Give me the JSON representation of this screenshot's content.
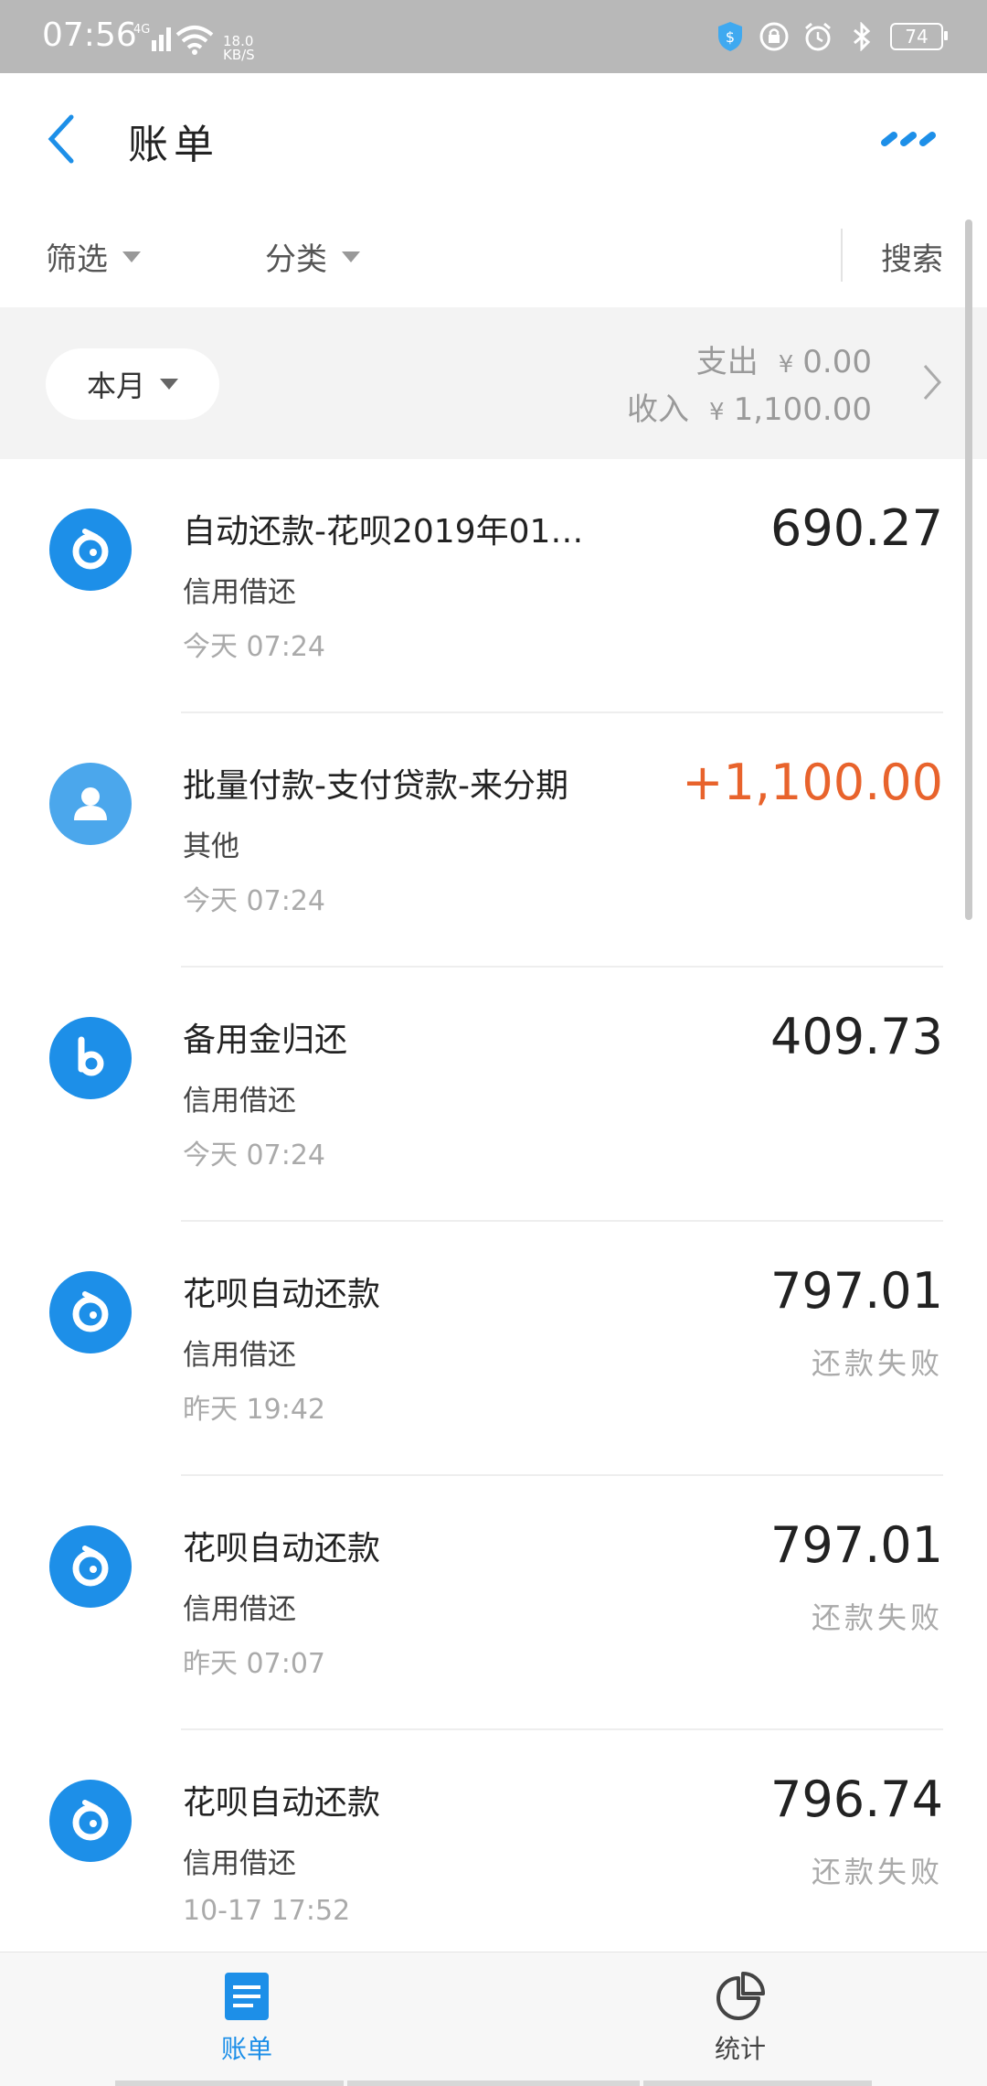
{
  "status_bar": {
    "time": "07:56",
    "network": "4G",
    "speed_value": "18.0",
    "speed_unit": "KB/S",
    "battery": "74"
  },
  "header": {
    "title": "账单"
  },
  "filters": {
    "filter_label": "筛选",
    "category_label": "分类",
    "search_label": "搜索"
  },
  "summary": {
    "month_label": "本月",
    "expense_label": "支出",
    "expense_value": "0.00",
    "income_label": "收入",
    "income_value": "1,100.00",
    "currency": "¥"
  },
  "transactions": [
    {
      "title": "自动还款-花呗2019年01…",
      "category": "信用借还",
      "time": "今天 07:24",
      "amount": "690.27",
      "status": "",
      "icon": "huabei-icon",
      "income": false
    },
    {
      "title": "批量付款-支付贷款-来分期",
      "category": "其他",
      "time": "今天 07:24",
      "amount": "+1,100.00",
      "status": "",
      "icon": "person-icon",
      "income": true
    },
    {
      "title": "备用金归还",
      "category": "信用借还",
      "time": "今天 07:24",
      "amount": "409.73",
      "status": "",
      "icon": "beiyongjin-icon",
      "income": false
    },
    {
      "title": "花呗自动还款",
      "category": "信用借还",
      "time": "昨天 19:42",
      "amount": "797.01",
      "status": "还款失败",
      "icon": "huabei-icon",
      "income": false
    },
    {
      "title": "花呗自动还款",
      "category": "信用借还",
      "time": "昨天 07:07",
      "amount": "797.01",
      "status": "还款失败",
      "icon": "huabei-icon",
      "income": false
    },
    {
      "title": "花呗自动还款",
      "category": "信用借还",
      "time": "10-17 17:52",
      "amount": "796.74",
      "status": "还款失败",
      "icon": "huabei-icon",
      "income": false
    }
  ],
  "tabbar": {
    "bill_label": "账单",
    "stats_label": "统计"
  },
  "colors": {
    "accent": "#1d8fe8",
    "income": "#e8632c"
  }
}
